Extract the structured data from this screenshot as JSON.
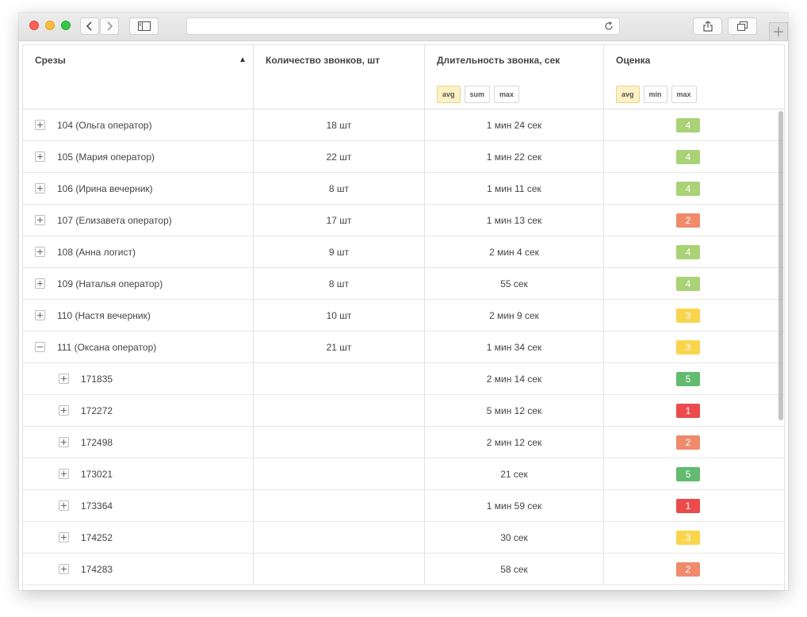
{
  "browser": {
    "back_label": "‹",
    "forward_label": "›",
    "url": ""
  },
  "colors": {
    "grade_1": "#ec4b4b",
    "grade_2": "#ef8a6b",
    "grade_3": "#f9d54e",
    "grade_4": "#aad276",
    "grade_5": "#62bb6f",
    "chip_active": "#fcf1c4"
  },
  "table": {
    "columns": [
      {
        "label": "Срезы",
        "sort": "▲"
      },
      {
        "label": "Количество звонков, шт"
      },
      {
        "label": "Длительность звонка, сек",
        "chips": [
          {
            "label": "avg",
            "active": true
          },
          {
            "label": "sum",
            "active": false
          },
          {
            "label": "max",
            "active": false
          }
        ]
      },
      {
        "label": "Оценка",
        "chips": [
          {
            "label": "avg",
            "active": true
          },
          {
            "label": "min",
            "active": false
          },
          {
            "label": "max",
            "active": false
          }
        ]
      }
    ],
    "rows": [
      {
        "label": "104 (Ольга оператор)",
        "count": "18 шт",
        "duration": "1 мин 24 сек",
        "grade": "4",
        "level": 0,
        "expanded": false
      },
      {
        "label": "105 (Мария оператор)",
        "count": "22 шт",
        "duration": "1 мин 22 сек",
        "grade": "4",
        "level": 0,
        "expanded": false
      },
      {
        "label": "106 (Ирина вечерник)",
        "count": "8 шт",
        "duration": "1 мин 11 сек",
        "grade": "4",
        "level": 0,
        "expanded": false
      },
      {
        "label": "107 (Елизавета оператор)",
        "count": "17 шт",
        "duration": "1 мин 13 сек",
        "grade": "2",
        "level": 0,
        "expanded": false
      },
      {
        "label": "108 (Анна логист)",
        "count": "9 шт",
        "duration": "2 мин 4 сек",
        "grade": "4",
        "level": 0,
        "expanded": false
      },
      {
        "label": "109 (Наталья оператор)",
        "count": "8 шт",
        "duration": "55 сек",
        "grade": "4",
        "level": 0,
        "expanded": false
      },
      {
        "label": "110 (Настя вечерник)",
        "count": "10 шт",
        "duration": "2 мин 9 сек",
        "grade": "3",
        "level": 0,
        "expanded": false
      },
      {
        "label": "111 (Оксана оператор)",
        "count": "21 шт",
        "duration": "1 мин 34 сек",
        "grade": "3",
        "level": 0,
        "expanded": true
      },
      {
        "label": "171835",
        "count": "",
        "duration": "2 мин 14 сек",
        "grade": "5",
        "level": 1,
        "expanded": false
      },
      {
        "label": "172272",
        "count": "",
        "duration": "5 мин 12 сек",
        "grade": "1",
        "level": 1,
        "expanded": false
      },
      {
        "label": "172498",
        "count": "",
        "duration": "2 мин 12 сек",
        "grade": "2",
        "level": 1,
        "expanded": false
      },
      {
        "label": "173021",
        "count": "",
        "duration": "21 сек",
        "grade": "5",
        "level": 1,
        "expanded": false
      },
      {
        "label": "173364",
        "count": "",
        "duration": "1 мин 59 сек",
        "grade": "1",
        "level": 1,
        "expanded": false
      },
      {
        "label": "174252",
        "count": "",
        "duration": "30 сек",
        "grade": "3",
        "level": 1,
        "expanded": false
      },
      {
        "label": "174283",
        "count": "",
        "duration": "58 сек",
        "grade": "2",
        "level": 1,
        "expanded": false
      }
    ]
  }
}
